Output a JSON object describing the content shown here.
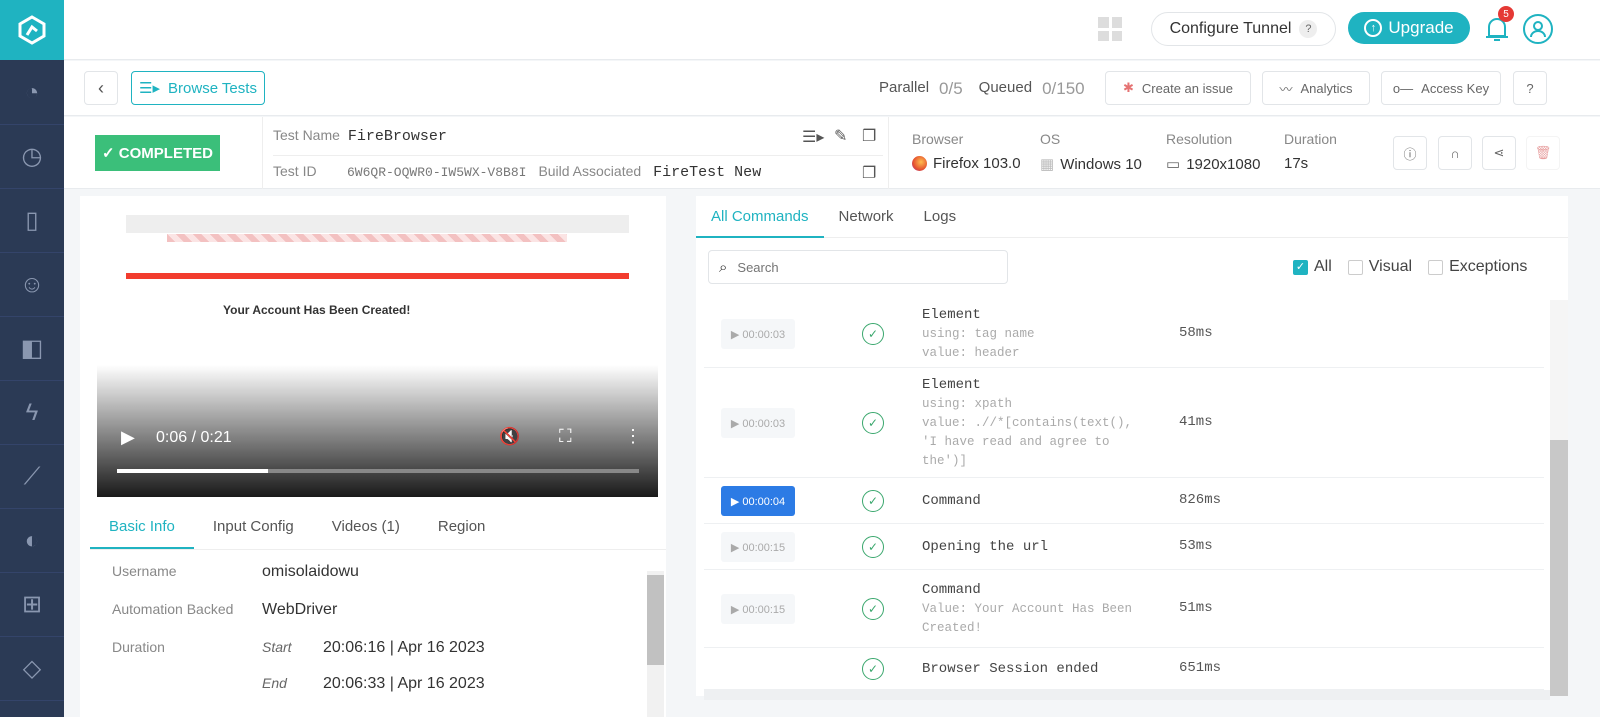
{
  "colors": {
    "accent": "#1fb3c1",
    "sidebar": "#2b3a55",
    "success": "#3bbf7a",
    "active_ts": "#2c7be5"
  },
  "sidebar": {
    "icons": [
      "logo-icon",
      "dashboard-gauge-icon",
      "clock-history-icon",
      "mobile-bolt-icon",
      "robot-icon",
      "split-screen-icon",
      "lightning-icon",
      "analytics-chart-icon",
      "circle-half-icon",
      "plus-square-icon",
      "apps-shapes-icon"
    ]
  },
  "topbar": {
    "configure_tunnel": "Configure Tunnel",
    "help": "?",
    "upgrade": "Upgrade",
    "notifications_count": "5"
  },
  "subbar": {
    "browse_tests": "Browse Tests",
    "parallel_label": "Parallel",
    "parallel_value": "0/5",
    "queued_label": "Queued",
    "queued_value": "0/150",
    "create_issue": "Create an issue",
    "analytics": "Analytics",
    "access_key": "Access Key",
    "help": "?"
  },
  "test": {
    "status": "✓ COMPLETED",
    "name_label": "Test Name",
    "name": "FireBrowser",
    "id_label": "Test ID",
    "id": "6W6QR-OQWR0-IW5WX-V8B8I",
    "build_label": "Build Associated",
    "build": "FireTest New",
    "browser_label": "Browser",
    "browser": "Firefox 103.0",
    "os_label": "OS",
    "os": "Windows 10",
    "resolution_label": "Resolution",
    "resolution": "1920x1080",
    "duration_label": "Duration",
    "duration": "17s"
  },
  "video": {
    "time": "0:06 / 0:21",
    "progress": 0.29,
    "page_heading": "Your Account Has Been Created!"
  },
  "info_tabs": [
    "Basic Info",
    "Input Config",
    "Videos (1)",
    "Region"
  ],
  "basic_info": {
    "username_label": "Username",
    "username": "omisolaidowu",
    "automation_label": "Automation Backed",
    "automation": "WebDriver",
    "duration_label": "Duration",
    "start_label": "Start",
    "start": "20:06:16 | Apr 16 2023",
    "end_label": "End",
    "end": "20:06:33 | Apr 16 2023"
  },
  "command_tabs": [
    "All Commands",
    "Network",
    "Logs"
  ],
  "search": {
    "placeholder": "Search"
  },
  "filters": [
    {
      "label": "All",
      "checked": true
    },
    {
      "label": "Visual",
      "checked": false
    },
    {
      "label": "Exceptions",
      "checked": false
    }
  ],
  "commands": [
    {
      "ts": "▶ 00:00:03",
      "title": "Element",
      "sub": [
        "using: tag name",
        "value: header"
      ],
      "dur": "58ms"
    },
    {
      "ts": "▶ 00:00:03",
      "title": "Element",
      "sub": [
        "using: xpath",
        "value: .//*[contains(text(),",
        "'I have read and agree to",
        "the')]"
      ],
      "dur": "41ms"
    },
    {
      "ts": "▶ 00:00:04",
      "title": "Command",
      "sub": [],
      "dur": "826ms",
      "active": true
    },
    {
      "ts": "▶ 00:00:15",
      "title": "Opening the url",
      "sub": [],
      "dur": "53ms"
    },
    {
      "ts": "▶ 00:00:15",
      "title": "Command",
      "sub": [
        "Value: Your Account Has Been",
        "Created!"
      ],
      "dur": "51ms"
    },
    {
      "ts": "",
      "title": "Browser Session ended",
      "sub": [],
      "dur": "651ms"
    }
  ]
}
